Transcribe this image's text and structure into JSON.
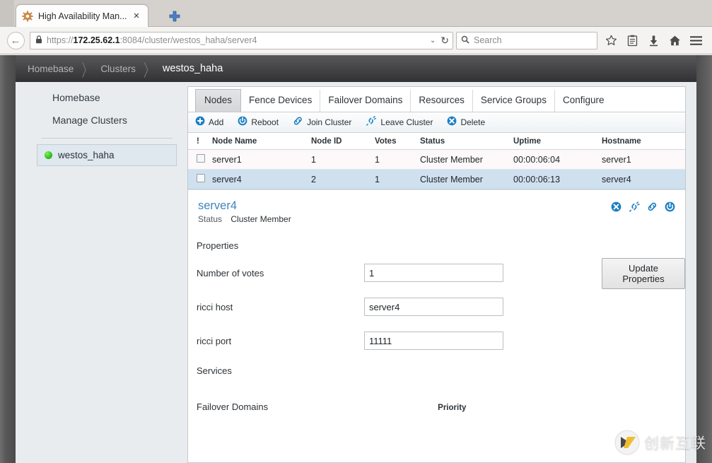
{
  "browser": {
    "tab": {
      "title": "High Availability Man...",
      "favicon": "gear-icon",
      "close": "×"
    },
    "newtab_label": "+",
    "back_glyph": "←",
    "url": {
      "scheme": "https://",
      "host": "172.25.62.1",
      "rest": ":8084/cluster/westos_haha/server4",
      "lock": "lock-icon",
      "dropdown": "⌄",
      "reload": "↻"
    },
    "search": {
      "placeholder": "Search",
      "icon": "search-icon"
    },
    "toolbar_icons": [
      "bookmark-star-icon",
      "library-icon",
      "download-icon",
      "home-icon",
      "menu-icon"
    ]
  },
  "breadcrumb": {
    "items": [
      "Homebase",
      "Clusters",
      "westos_haha"
    ],
    "separator": "〉"
  },
  "sidebar": {
    "links": [
      "Homebase",
      "Manage Clusters"
    ],
    "cluster": {
      "label": "westos_haha",
      "status_color": "#2fbf17"
    }
  },
  "tabs": [
    {
      "label": "Nodes",
      "active": true
    },
    {
      "label": "Fence Devices",
      "active": false
    },
    {
      "label": "Failover Domains",
      "active": false
    },
    {
      "label": "Resources",
      "active": false
    },
    {
      "label": "Service Groups",
      "active": false
    },
    {
      "label": "Configure",
      "active": false
    }
  ],
  "toolbar": [
    {
      "label": "Add",
      "icon": "plus-circle-icon"
    },
    {
      "label": "Reboot",
      "icon": "power-gear-icon"
    },
    {
      "label": "Join Cluster",
      "icon": "link-icon"
    },
    {
      "label": "Leave Cluster",
      "icon": "broken-link-icon"
    },
    {
      "label": "Delete",
      "icon": "x-circle-icon"
    }
  ],
  "table": {
    "headers": [
      "!",
      "Node Name",
      "Node ID",
      "Votes",
      "Status",
      "Uptime",
      "Hostname"
    ],
    "rows": [
      {
        "checked": false,
        "name": "server1",
        "id": "1",
        "votes": "1",
        "status": "Cluster Member",
        "uptime": "00:00:06:04",
        "hostname": "server1",
        "selected": false
      },
      {
        "checked": false,
        "name": "server4",
        "id": "2",
        "votes": "1",
        "status": "Cluster Member",
        "uptime": "00:00:06:13",
        "hostname": "server4",
        "selected": true
      }
    ]
  },
  "detail": {
    "title": "server4",
    "status_label": "Status",
    "status_value": "Cluster Member",
    "icons": [
      "delete-x-icon",
      "leave-cluster-icon",
      "join-cluster-icon",
      "reboot-icon"
    ]
  },
  "properties": {
    "section_title": "Properties",
    "fields": [
      {
        "label": "Number of votes",
        "value": "1"
      },
      {
        "label": "ricci host",
        "value": "server4"
      },
      {
        "label": "ricci port",
        "value": "11111"
      }
    ],
    "update_button": "Update Properties"
  },
  "sections": {
    "services": "Services",
    "failover_domains": "Failover Domains",
    "priority": "Priority"
  },
  "watermark": {
    "text": "创新互联"
  },
  "colors": {
    "accent_blue": "#1b7fc4",
    "title_blue": "#3f86bd",
    "selected_row": "#cfe0ef",
    "status_green": "#2fbf17"
  }
}
